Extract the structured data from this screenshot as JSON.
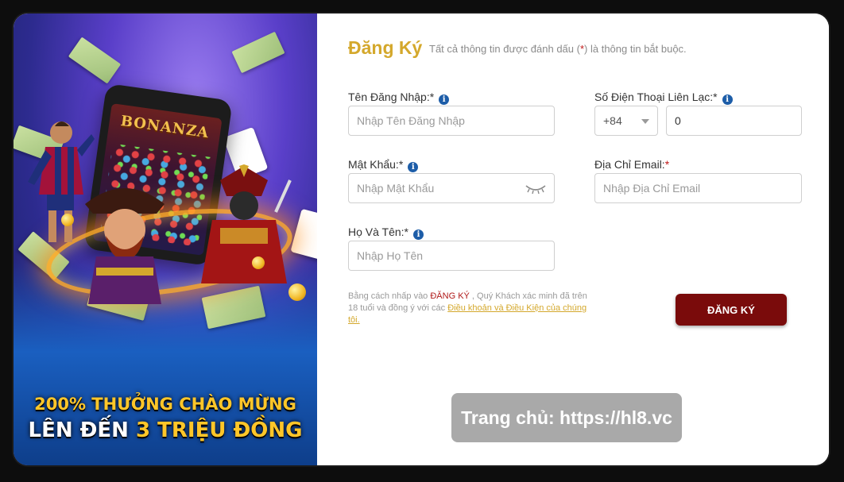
{
  "banner": {
    "promo_line1": "200% THƯỞNG CHÀO MỪNG",
    "promo_line2_part1": "LÊN ĐẾN ",
    "promo_line2_part2": "3 TRIỆU ĐỒNG",
    "game_title": "BONANZA"
  },
  "form": {
    "title": "Đăng Ký",
    "subtitle_part1": "Tất cả thông tin được đánh dấu (",
    "subtitle_required_mark": "*",
    "subtitle_part2": ") là thông tin bắt buộc.",
    "username": {
      "label": "Tên Đăng Nhập:*",
      "placeholder": "Nhập Tên Đăng Nhập"
    },
    "phone": {
      "label": "Số Điện Thoại Liên Lạc:*",
      "country_code": "+84",
      "value": "0"
    },
    "password": {
      "label": "Mật Khẩu:*",
      "placeholder": "Nhập Mật Khẩu"
    },
    "email": {
      "label": "Địa Chỉ Email:",
      "required_mark": "*",
      "placeholder": "Nhập Địa Chỉ Email"
    },
    "fullname": {
      "label": "Họ Và Tên:*",
      "placeholder": "Nhập Họ Tên"
    },
    "info_icon_glyph": "i",
    "terms": {
      "part1": "Bằng cách nhấp vào ",
      "brand_word": "ĐĂNG KÝ",
      "part2": " , Quý Khách xác minh đã trên 18 tuổi và đồng ý với các ",
      "link": "Điều khoản và Điều Kiện của chúng tôi."
    },
    "submit_label": "ĐĂNG KÝ"
  },
  "watermark": "Trang chủ: https://hl8.vc",
  "colors": {
    "title_gold": "#d4a82c",
    "submit_bg": "#7a0b0b",
    "info_blue": "#1d5da8",
    "required_red": "#c01818"
  }
}
